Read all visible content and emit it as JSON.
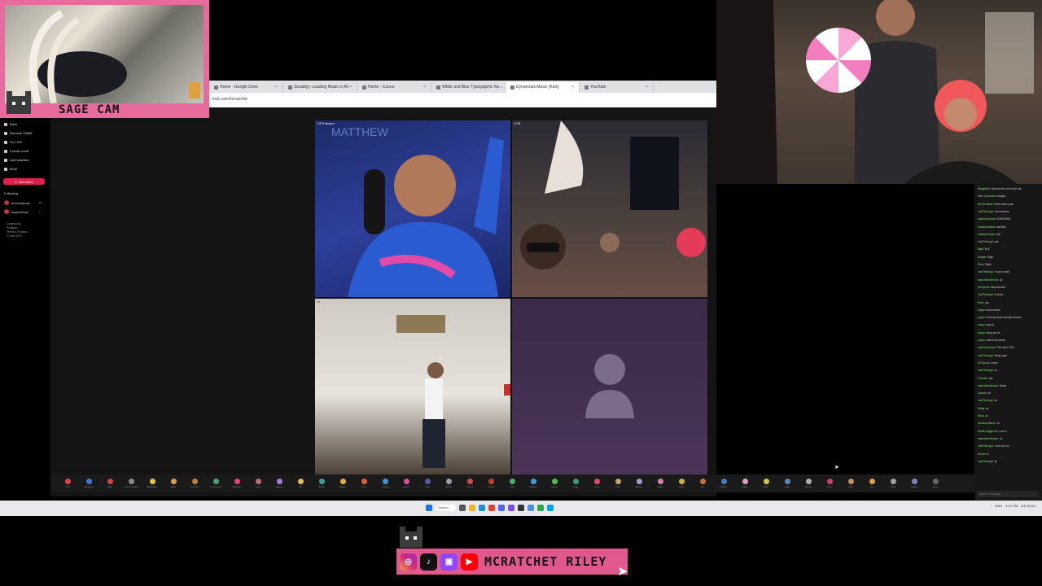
{
  "browser": {
    "tabs": [
      {
        "label": "Home - Google Drive",
        "active": false
      },
      {
        "label": "Sociallyy: Loading Music in All",
        "active": false
      },
      {
        "label": "Home - Canva",
        "active": false
      },
      {
        "label": "White and Blue Typographic Ne...",
        "active": false
      },
      {
        "label": "Dynamous Music (Kick)",
        "active": true
      },
      {
        "label": "YouTube",
        "active": false
      }
    ],
    "address": "kick.com/mcratchet"
  },
  "sidebar": {
    "nav": [
      "Back",
      "Discover KAME",
      "Go LIVE",
      "Creator tools",
      "Just watched",
      "More"
    ],
    "get_coins_label": "Get Coins",
    "following_title": "Following",
    "following": [
      {
        "name": "dnchnidpunk",
        "sub": "Just Chatting",
        "count": "10"
      },
      {
        "name": "supportkapi",
        "sub": "Chatting",
        "count": "7"
      }
    ],
    "footer_links": [
      "Community",
      "Program",
      "Terms & Policies",
      "© Kick 2024"
    ]
  },
  "video_grid": {
    "tiles": [
      {
        "label": "MATTHEW",
        "corner": "1,978 viewers"
      },
      {
        "label": "3,761",
        "corner": ""
      },
      {
        "label": "DJ",
        "corner": ""
      },
      {
        "label": "",
        "corner": ""
      }
    ]
  },
  "emote_bar": {
    "emotes": [
      {
        "label": "Kick",
        "color": "#e64343"
      },
      {
        "label": "Mogens",
        "color": "#3a7bd5"
      },
      {
        "label": "Bold",
        "color": "#d94343"
      },
      {
        "label": "Get Gi Glad",
        "color": "#888888"
      },
      {
        "label": "Bekkaboo",
        "color": "#f0c040"
      },
      {
        "label": "Hazy",
        "color": "#d9a14a"
      },
      {
        "label": "Peanut",
        "color": "#c77d3c"
      },
      {
        "label": "Lucky Cat",
        "color": "#4aa56a"
      },
      {
        "label": "Kick Her",
        "color": "#e6437a"
      },
      {
        "label": "Hug",
        "color": "#c46a6a"
      },
      {
        "label": "Hands",
        "color": "#a87edb"
      },
      {
        "label": "Ok",
        "color": "#e0c050"
      },
      {
        "label": "Smile",
        "color": "#40a0a0"
      },
      {
        "label": "Claps",
        "color": "#e6b040"
      },
      {
        "label": "Fire",
        "color": "#e65a30"
      },
      {
        "label": "Crying",
        "color": "#4a8ee0"
      },
      {
        "label": "Heart",
        "color": "#e64aa0"
      },
      {
        "label": "Sad",
        "color": "#5a5aa0"
      },
      {
        "label": "Bonk",
        "color": "#9aa0a6"
      },
      {
        "label": "Shook",
        "color": "#d84a4a"
      },
      {
        "label": "Angry",
        "color": "#c04030"
      },
      {
        "label": "Chili",
        "color": "#4ab070"
      },
      {
        "label": "Dance",
        "color": "#3aa0e0"
      },
      {
        "label": "Clover",
        "color": "#50c050"
      },
      {
        "label": "Frog",
        "color": "#3aa070"
      },
      {
        "label": "Love",
        "color": "#e64a6a"
      },
      {
        "label": "Pray",
        "color": "#c0a070"
      },
      {
        "label": "Bunny",
        "color": "#a0a0d0"
      },
      {
        "label": "Wave",
        "color": "#e07ab0"
      },
      {
        "label": "Hype",
        "color": "#d0b040"
      },
      {
        "label": "Fox",
        "color": "#d07040"
      },
      {
        "label": "Water",
        "color": "#4080c0"
      },
      {
        "label": "Cake",
        "color": "#e0a0c0"
      },
      {
        "label": "Star",
        "color": "#e0c040"
      },
      {
        "label": "Rain",
        "color": "#5a8ab0"
      },
      {
        "label": "Ghost",
        "color": "#b0b0b0"
      },
      {
        "label": "Rose",
        "color": "#d0406a"
      },
      {
        "label": "Cat",
        "color": "#c09060"
      },
      {
        "label": "Sun",
        "color": "#e0a040"
      },
      {
        "label": "Skull",
        "color": "#a0a0a0"
      },
      {
        "label": "Moon",
        "color": "#8080c0"
      },
      {
        "label": "More",
        "color": "#666666"
      }
    ]
  },
  "chat": {
    "messages": [
      {
        "user": "BadgerBoi",
        "text": "Nah but the one in the hat"
      },
      {
        "user": "Ellen Camnotes",
        "text": "banger"
      },
      {
        "user": "GirlTyconlsts",
        "text": "Ill the views eyes"
      },
      {
        "user": "JustTheDog3",
        "text": "new weirdos"
      },
      {
        "user": "craberyGrandz",
        "text": "DOWN BAD"
      },
      {
        "user": "Amanda Marks",
        "text": "wait like"
      },
      {
        "user": "cradleyGrandz",
        "text": "nah"
      },
      {
        "user": "JustTheDog3",
        "text": "yes"
      },
      {
        "user": "Maid",
        "text": "fix it"
      },
      {
        "user": "Amarjit",
        "text": "Right"
      },
      {
        "user": "Ross",
        "text": "Right"
      },
      {
        "user": "JustTheDog3",
        "text": "I wore a skirt"
      },
      {
        "user": "marcellamohnson",
        "text": "ok"
      },
      {
        "user": "GirlTyconl",
        "text": "this shit hard"
      },
      {
        "user": "JustTheDog3",
        "text": "ill show"
      },
      {
        "user": "Ross",
        "text": "yes"
      },
      {
        "user": "prcyar",
        "text": "keep dancer"
      },
      {
        "user": "prcyar",
        "text": "Fat boy dancer please remove"
      },
      {
        "user": "prcyar",
        "text": "say ok"
      },
      {
        "user": "prcyar",
        "text": "bring up me"
      },
      {
        "user": "prcyar",
        "text": "switch my dance"
      },
      {
        "user": "craberyGrandz",
        "text": "THE and LOVE"
      },
      {
        "user": "JustTheDog3",
        "text": "Bring back"
      },
      {
        "user": "GirlTyconl",
        "text": "i need"
      },
      {
        "user": "JustTheDog3",
        "text": "so"
      },
      {
        "user": "Cohmen",
        "text": "this"
      },
      {
        "user": "marcellamohnson",
        "text": "Music"
      },
      {
        "user": "Linaree",
        "text": "ok"
      },
      {
        "user": "JustTheDog3",
        "text": "ok"
      },
      {
        "user": "Ridrig",
        "text": "ok"
      },
      {
        "user": "Ross",
        "text": "ok"
      },
      {
        "user": "Amanda Marks",
        "text": "ok"
      },
      {
        "user": "Studio Higgenmd",
        "text": "Love u"
      },
      {
        "user": "marcellamohnson",
        "text": "ok"
      },
      {
        "user": "JustTheDog3",
        "text": "I love you so"
      },
      {
        "user": "fernch",
        "text": "hi"
      },
      {
        "user": "JustTheDog3",
        "text": "ok"
      }
    ],
    "input_placeholder": "Send a message"
  },
  "taskbar": {
    "search_label": "Search",
    "tray": [
      "^",
      "ENG",
      "4:21 PM",
      "4/17/2024"
    ]
  },
  "sage_cam": {
    "title": "SAGE CAM"
  },
  "social": {
    "icons": [
      "instagram-icon",
      "tiktok-icon",
      "twitch-icon",
      "youtube-icon"
    ],
    "handle": "MCRATCHET RILEY"
  },
  "colors": {
    "accent": "#e1588f",
    "kick_red": "#e2214a",
    "kick_green": "#53fc18"
  }
}
